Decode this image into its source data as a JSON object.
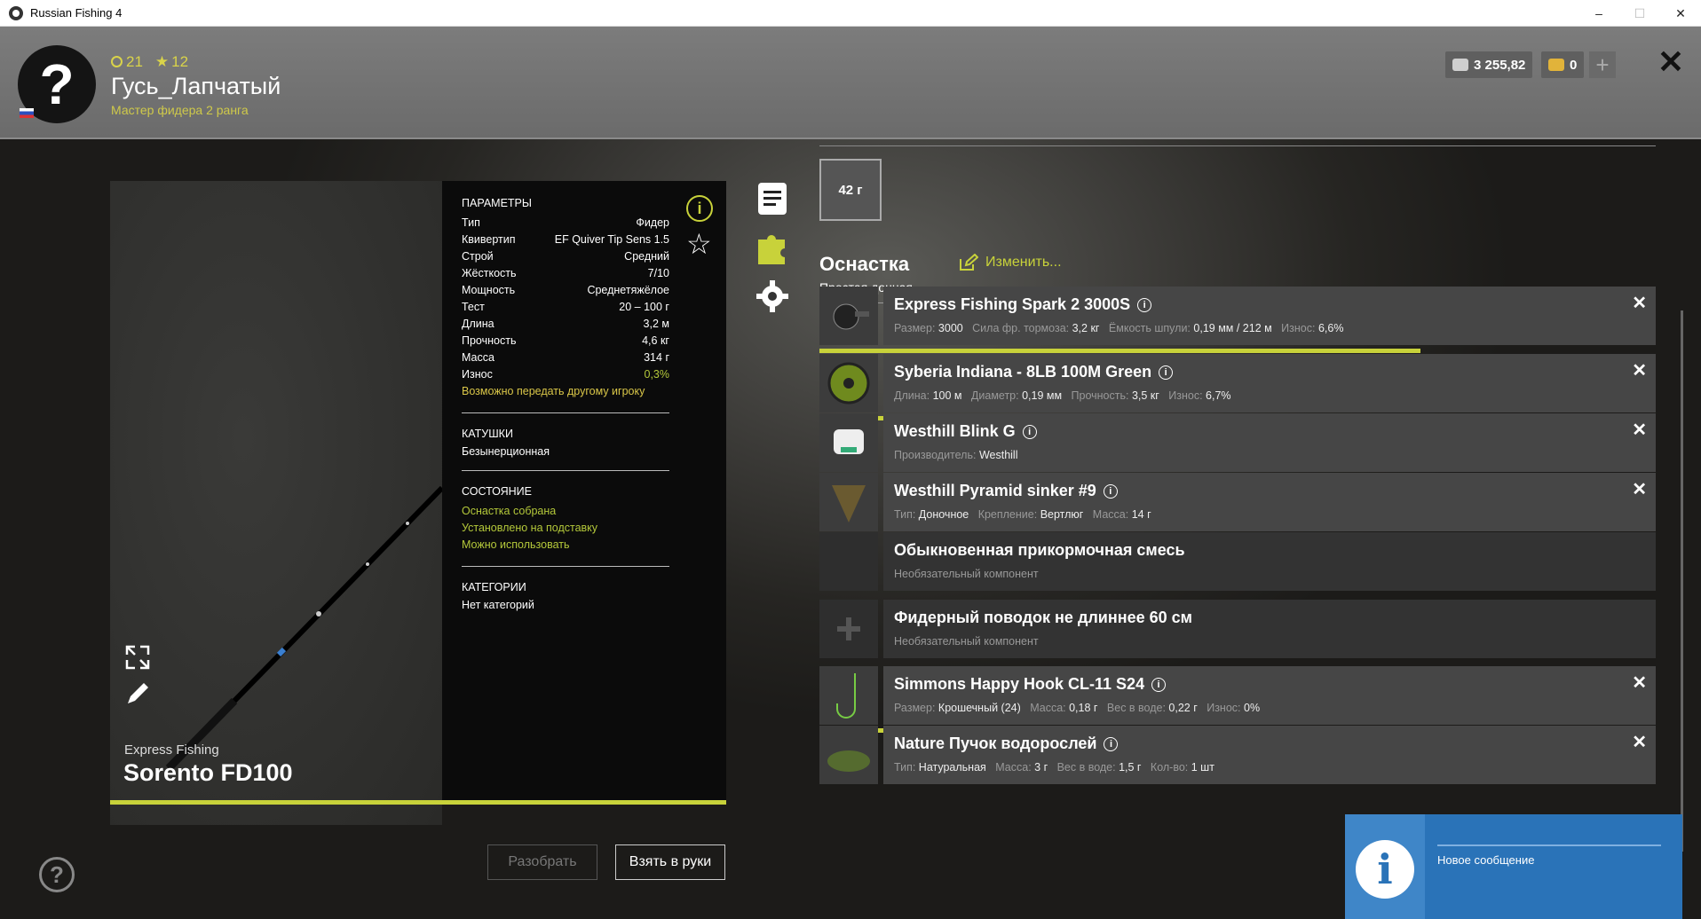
{
  "window": {
    "title": "Russian Fishing 4",
    "minimize": "–",
    "maximize": "☐",
    "close": "✕"
  },
  "player": {
    "avatar": "?",
    "level": "21",
    "stars": "12",
    "name": "Гусь_Лапчатый",
    "rank": "Мастер фидера 2 ранга"
  },
  "currency": {
    "silver": "3 255,82",
    "gold": "0",
    "add": "+"
  },
  "close_label": "✕",
  "rod": {
    "brand": "Express Fishing",
    "name": "Sorento FD100",
    "params_title": "ПАРАМЕТРЫ",
    "params": [
      {
        "k": "Тип",
        "v": "Фидер"
      },
      {
        "k": "Квивертип",
        "v": "EF Quiver Tip Sens 1.5"
      },
      {
        "k": "Строй",
        "v": "Средний"
      },
      {
        "k": "Жёсткость",
        "v": "7/10"
      },
      {
        "k": "Мощность",
        "v": "Среднетяжёлое"
      },
      {
        "k": "Тест",
        "v": "20 – 100 г"
      },
      {
        "k": "Длина",
        "v": "3,2 м"
      },
      {
        "k": "Прочность",
        "v": "4,6 кг"
      },
      {
        "k": "Масса",
        "v": "314 г"
      },
      {
        "k": "Износ",
        "v": "0,3%"
      }
    ],
    "transfer_note": "Возможно передать другому игроку",
    "reels_title": "КАТУШКИ",
    "reels_value": "Безынерционная",
    "state_title": "СОСТОЯНИЕ",
    "state": [
      "Оснастка собрана",
      "Установлено на подставку",
      "Можно использовать"
    ],
    "categories_title": "КАТЕГОРИИ",
    "categories_value": "Нет категорий"
  },
  "buttons": {
    "disassemble": "Разобрать",
    "take": "Взять в руки"
  },
  "weight": "42 г",
  "rig": {
    "title": "Оснастка",
    "subtitle": "Простая донная",
    "edit": "Изменить..."
  },
  "slots": [
    {
      "name": "Express Fishing Spark 2 3000S",
      "details": [
        [
          "Размер:",
          "3000"
        ],
        [
          "Сила фр. тормоза:",
          "3,2 кг"
        ],
        [
          "Ёмкость шпули:",
          "0,19 мм / 212 м"
        ],
        [
          "Износ:",
          "6,6%"
        ]
      ],
      "wear": 0.94
    },
    {
      "name": "Syberia Indiana - 8LB 100M Green",
      "details": [
        [
          "Длина:",
          "100 м"
        ],
        [
          "Диаметр:",
          "0,19 мм"
        ],
        [
          "Прочность:",
          "3,5 кг"
        ],
        [
          "Износ:",
          "6,7%"
        ]
      ],
      "wear": 0.93
    },
    {
      "name": "Westhill Blink G",
      "details": [
        [
          "Производитель:",
          "Westhill"
        ]
      ]
    },
    {
      "name": "Westhill Pyramid sinker #9",
      "details": [
        [
          "Тип:",
          "Доночное"
        ],
        [
          "Крепление:",
          "Вертлюг"
        ],
        [
          "Масса:",
          "14 г"
        ]
      ]
    },
    {
      "name": "Обыкновенная прикормочная смесь",
      "details": [
        [
          "Необязательный компонент",
          ""
        ]
      ]
    },
    {
      "name": "Фидерный поводок не длиннее 60 см",
      "details": [
        [
          "Необязательный компонент",
          ""
        ]
      ]
    },
    {
      "name": "Simmons Happy Hook CL-11 S24",
      "details": [
        [
          "Размер:",
          "Крошечный (24)"
        ],
        [
          "Масса:",
          "0,18 г"
        ],
        [
          "Вес в воде:",
          "0,22 г"
        ],
        [
          "Износ:",
          "0%"
        ]
      ],
      "wear": 1.0
    },
    {
      "name": "Nature Пучок водорослей",
      "details": [
        [
          "Тип:",
          "Натуральная"
        ],
        [
          "Масса:",
          "3 г"
        ],
        [
          "Вес в воде:",
          "1,5 г"
        ],
        [
          "Кол-во:",
          "1 шт"
        ]
      ]
    }
  ],
  "toast": {
    "message": "Новое сообщение"
  },
  "colors": {
    "accent": "#c8d23a",
    "toast": "#2a73b8"
  }
}
